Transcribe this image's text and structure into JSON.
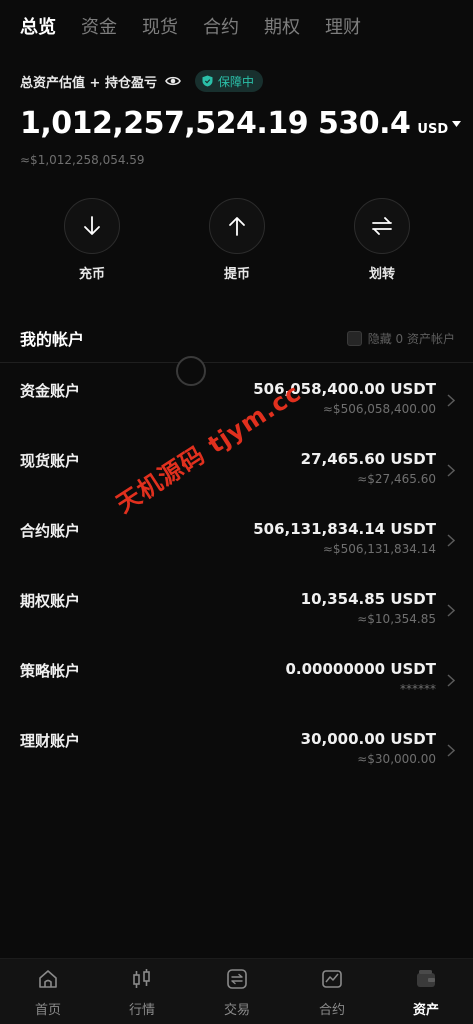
{
  "tabs": [
    "总览",
    "资金",
    "现货",
    "合约",
    "期权",
    "理财"
  ],
  "header": {
    "asset_label": "总资产估值 + 持仓盈亏",
    "protect_badge": "保障中",
    "total_value": "1,012,257,524.19 530.4",
    "total_unit": "USD",
    "total_approx": "≈$1,012,258,054.59"
  },
  "actions": [
    {
      "label": "充币",
      "icon": "arrow-down-icon"
    },
    {
      "label": "提币",
      "icon": "arrow-up-icon"
    },
    {
      "label": "划转",
      "icon": "transfer-icon"
    }
  ],
  "accounts": {
    "title": "我的帐户",
    "hide_zero_label": "隐藏 0 资产帐户",
    "items": [
      {
        "name": "资金账户",
        "value": "506,058,400.00 USDT",
        "approx": "≈$506,058,400.00"
      },
      {
        "name": "现货账户",
        "value": "27,465.60 USDT",
        "approx": "≈$27,465.60"
      },
      {
        "name": "合约账户",
        "value": "506,131,834.14 USDT",
        "approx": "≈$506,131,834.14"
      },
      {
        "name": "期权账户",
        "value": "10,354.85 USDT",
        "approx": "≈$10,354.85"
      },
      {
        "name": "策略帐户",
        "value": "0.00000000 USDT",
        "approx": "******"
      },
      {
        "name": "理财账户",
        "value": "30,000.00 USDT",
        "approx": "≈$30,000.00"
      }
    ]
  },
  "watermark": "天机源码 tjym.cc",
  "bottom_nav": [
    {
      "label": "首页",
      "icon": "home-icon"
    },
    {
      "label": "行情",
      "icon": "candlestick-icon"
    },
    {
      "label": "交易",
      "icon": "trade-icon"
    },
    {
      "label": "合约",
      "icon": "contract-chart-icon"
    },
    {
      "label": "资产",
      "icon": "wallet-icon",
      "active": true
    }
  ],
  "colors": {
    "background": "#0b0b0b",
    "accent_teal": "#2bc0a9",
    "watermark_red": "#e1301e"
  }
}
